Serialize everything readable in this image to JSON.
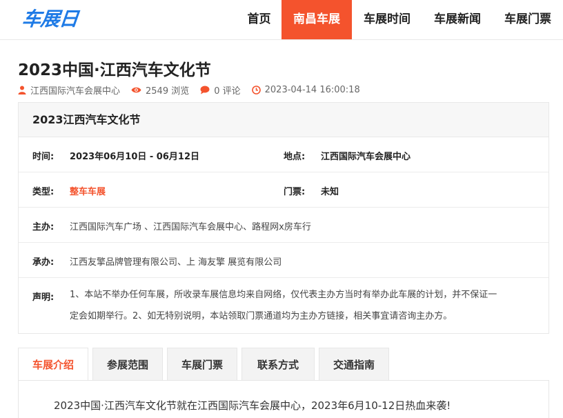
{
  "header": {
    "logo": "车展日",
    "nav": [
      "首页",
      "南昌车展",
      "车展时间",
      "车展新闻",
      "车展门票"
    ],
    "active_index": 1
  },
  "article": {
    "title": "2023中国·江西汽车文化节",
    "meta": {
      "author": "江西国际汽车会展中心",
      "views": "2549 浏览",
      "comments": "0 评论",
      "datetime": "2023-04-14 16:00:18"
    }
  },
  "info": {
    "heading": "2023江西汽车文化节",
    "time_label": "时间:",
    "time_value": "2023年06月10日 - 06月12日",
    "place_label": "地点:",
    "place_value": "江西国际汽车会展中心",
    "type_label": "类型:",
    "type_value": "整车车展",
    "ticket_label": "门票:",
    "ticket_value": "未知",
    "host_label": "主办:",
    "host_value": "江西国际汽车广场 、江西国际汽车会展中心、路程网x房车行",
    "organizer_label": "承办:",
    "organizer_value": "江西友擎品牌管理有限公司、上 海友擎 展览有限公司",
    "notice_label": "声明:",
    "notice_line1": "1、本站不举办任何车展，所收录车展信息均来自网络，仅代表主办方当时有举办此车展的计划，并不保证一",
    "notice_line2": "定会如期举行。2、如无特别说明，本站领取门票通道均为主办方链接，相关事宜请咨询主办方。"
  },
  "tabs": [
    "车展介绍",
    "参展范围",
    "车展门票",
    "联系方式",
    "交通指南"
  ],
  "intro_text": "2023中国·江西汽车文化节就在江西国际汽车会展中心，2023年6月10-12日热血来袭!",
  "colors": {
    "accent": "#f4532d",
    "logo": "#1f7be6"
  }
}
